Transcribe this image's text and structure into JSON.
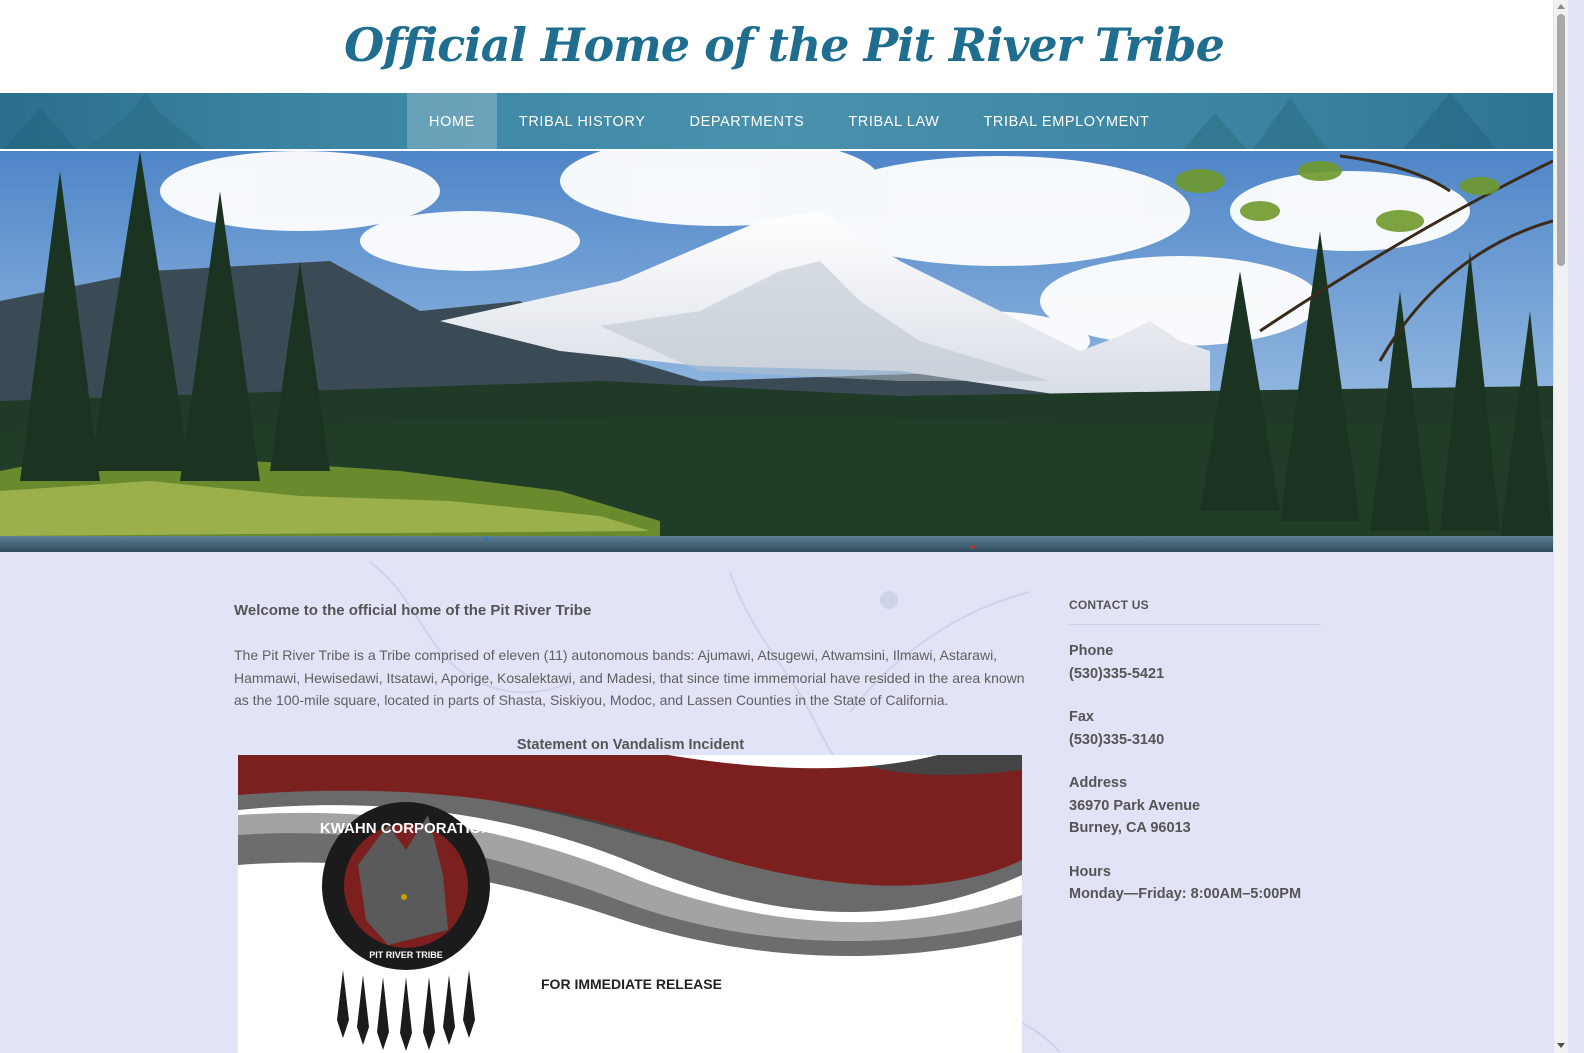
{
  "site": {
    "title": "Official Home of the Pit River Tribe"
  },
  "nav": {
    "items": [
      {
        "label": "HOME",
        "active": true
      },
      {
        "label": "TRIBAL HISTORY"
      },
      {
        "label": "DEPARTMENTS"
      },
      {
        "label": "TRIBAL LAW"
      },
      {
        "label": "TRIBAL EMPLOYMENT"
      }
    ]
  },
  "hero": {
    "image": "mountain-lake-landscape"
  },
  "main": {
    "welcome_heading": "Welcome to the official home of the Pit River Tribe",
    "intro": "The Pit River Tribe is a Tribe comprised of eleven (11) autonomous bands: Ajumawi, Atsugewi, Atwamsini, Ilmawi, Astarawi, Hammawi, Hewisedawi, Itsatawi, Aporige, Kosalektawi, and Madesi, that since time immemorial have resided in the area known as the 100-mile square, located in parts of Shasta, Siskiyou, Modoc, and Lassen Counties in the State of California.",
    "statement_heading": "Statement on Vandalism Incident",
    "press_release": {
      "logo_ring_top": "KWAHN CORPORATION",
      "logo_ring_bottom": "PIT RIVER TRIBE",
      "release_text": "FOR IMMEDIATE RELEASE"
    }
  },
  "sidebar": {
    "heading": "CONTACT US",
    "phone": {
      "label": "Phone",
      "value": "(530)335-5421"
    },
    "fax": {
      "label": "Fax",
      "value": "(530)335-3140"
    },
    "address": {
      "label": "Address",
      "line1": "36970 Park Avenue",
      "line2": "Burney, CA 96013"
    },
    "hours": {
      "label": "Hours",
      "value": "Monday—Friday: 8:00AM–5:00PM"
    }
  },
  "colors": {
    "title": "#1f6e8f",
    "nav": "#3b85a3",
    "page_bg": "#e1e3f7",
    "press_red": "#7c1f1f",
    "press_gray": "#5f5f5f"
  }
}
